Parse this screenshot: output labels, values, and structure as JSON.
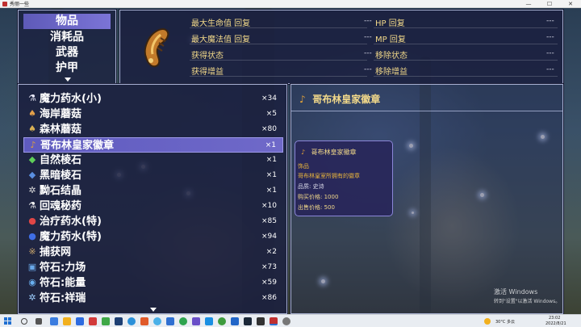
{
  "window": {
    "title": "秀丽一些"
  },
  "categories": {
    "items": [
      "物品",
      "消耗品",
      "武器",
      "护甲"
    ],
    "selected_index": 0
  },
  "stats": {
    "rows": [
      {
        "left_label": "最大生命值 回复",
        "left_value": "---",
        "right_label": "HP 回复",
        "right_value": "---"
      },
      {
        "left_label": "最大魔法值 回复",
        "left_value": "---",
        "right_label": "MP 回复",
        "right_value": "---"
      },
      {
        "left_label": "获得状态",
        "left_value": "---",
        "right_label": "移除状态",
        "right_value": "---"
      },
      {
        "left_label": "获得增益",
        "left_value": "---",
        "right_label": "移除增益",
        "right_value": "---"
      }
    ]
  },
  "items": {
    "rows": [
      {
        "name": "魔力药水(小)",
        "qty": "×34",
        "icon": "small-mana-potion-icon",
        "glyph": "⚗",
        "color": "#e8e8f8"
      },
      {
        "name": "海岸蘑菇",
        "qty": "×5",
        "icon": "coast-mushroom-icon",
        "glyph": "♠",
        "color": "#e3a04a"
      },
      {
        "name": "森林蘑菇",
        "qty": "×80",
        "icon": "forest-mushroom-icon",
        "glyph": "♠",
        "color": "#d8b055"
      },
      {
        "name": "哥布林皇家徽章",
        "qty": "×1",
        "icon": "goblin-royal-badge-icon",
        "glyph": "♪",
        "color": "#e0a13a"
      },
      {
        "name": "自然棱石",
        "qty": "×1",
        "icon": "nature-prism-icon",
        "glyph": "◆",
        "color": "#5fcf5a"
      },
      {
        "name": "黑暗棱石",
        "qty": "×1",
        "icon": "dark-prism-icon",
        "glyph": "◆",
        "color": "#5a8fe0"
      },
      {
        "name": "黝石结晶",
        "qty": "×1",
        "icon": "crystal-icon",
        "glyph": "✲",
        "color": "#dcdcdc"
      },
      {
        "name": "回魂秘药",
        "qty": "×10",
        "icon": "revive-elixir-icon",
        "glyph": "⚗",
        "color": "#f0f0f0"
      },
      {
        "name": "治疗药水(特)",
        "qty": "×85",
        "icon": "healing-potion-icon",
        "glyph": "●",
        "color": "#e04646"
      },
      {
        "name": "魔力药水(特)",
        "qty": "×94",
        "icon": "mana-potion-icon",
        "glyph": "●",
        "color": "#3f6ee6"
      },
      {
        "name": "捕获网",
        "qty": "×2",
        "icon": "capture-net-icon",
        "glyph": "※",
        "color": "#c9a66b"
      },
      {
        "name": "符石:力场",
        "qty": "×73",
        "icon": "rune-force-field-icon",
        "glyph": "▣",
        "color": "#6aa8e8"
      },
      {
        "name": "符石:能量",
        "qty": "×59",
        "icon": "rune-energy-icon",
        "glyph": "◉",
        "color": "#6ab0f0"
      },
      {
        "name": "符石:祥瑞",
        "qty": "×86",
        "icon": "rune-auspicious-icon",
        "glyph": "✲",
        "color": "#9fd0ff"
      }
    ],
    "selected_index": 3
  },
  "detail": {
    "header": "哥布林皇家徽章",
    "tooltip": {
      "title": "哥布林皇家徽章",
      "type": "饰品",
      "description": "哥布林皇室所拥有的徽章",
      "quality": "品质: 史诗",
      "buy_price": "购买价格: 1000",
      "sell_price": "出售价格: 500"
    }
  },
  "watermark": {
    "line1": "激活 Windows",
    "line2": "转到\"设置\"以激活 Windows。"
  },
  "taskbar": {
    "weather": "30°C 多云",
    "time": "23:02",
    "date": "2022/8/21"
  }
}
